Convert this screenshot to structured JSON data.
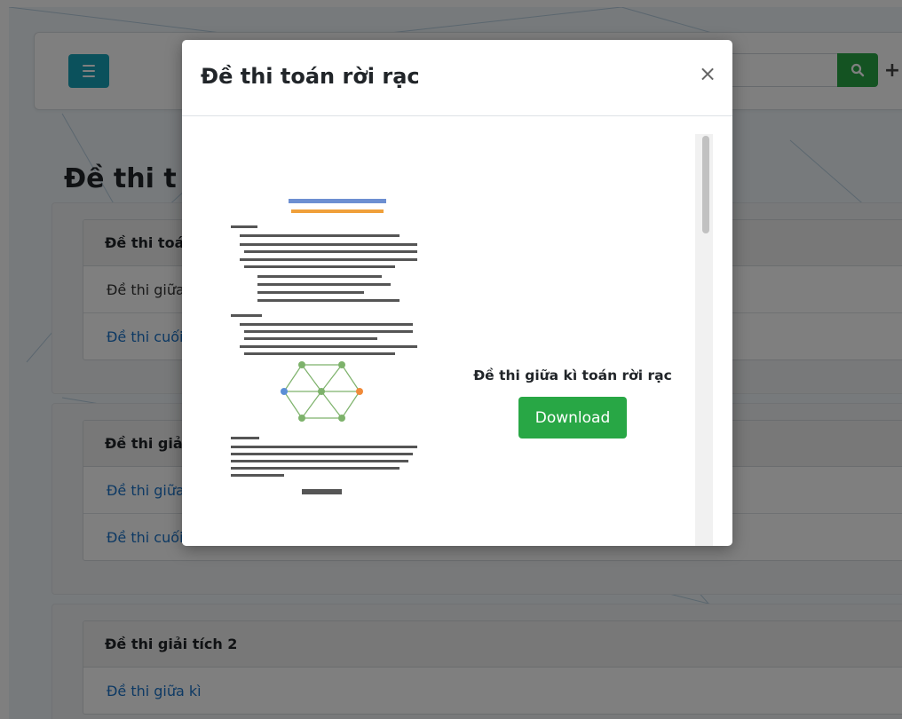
{
  "header": {
    "search_placeholder": "?",
    "plus_label": "+"
  },
  "page": {
    "title": "Đề thi t"
  },
  "sections": [
    {
      "header": "Đề thi toán",
      "items": [
        {
          "label": "Đề thi giữa",
          "link": false
        },
        {
          "label": "Đề thi cuối",
          "link": true
        }
      ]
    },
    {
      "header": "Đề thi giải",
      "items": [
        {
          "label": "Đề thi giữa",
          "link": true
        },
        {
          "label": "Đề thi cuối kì",
          "link": true
        }
      ]
    },
    {
      "header": "Đề thi giải tích 2",
      "items": [
        {
          "label": "Đề thi giữa kì",
          "link": true
        }
      ]
    }
  ],
  "modal": {
    "title": "Đề thi toán rời rạc",
    "close_label": "×",
    "file_title": "Đề thi giữa kì toán rời rạc",
    "download_label": "Download"
  },
  "colors": {
    "menu_button": "#17a2b8",
    "success": "#28a745",
    "link": "#1a73c8"
  }
}
